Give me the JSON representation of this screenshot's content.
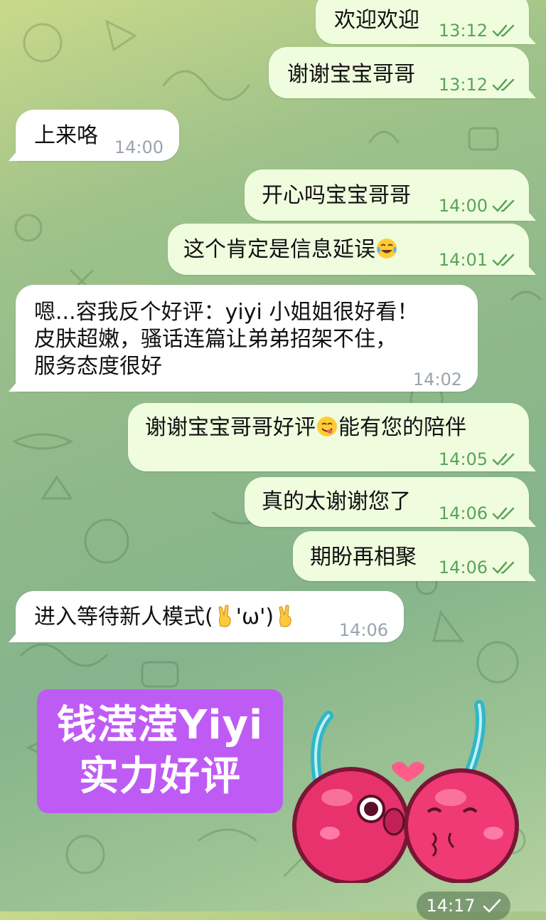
{
  "messages": [
    {
      "id": "m1",
      "dir": "out",
      "text": "欢迎欢迎",
      "time": "13:12",
      "ticks": "double"
    },
    {
      "id": "m2",
      "dir": "out",
      "text": "谢谢宝宝哥哥",
      "time": "13:12",
      "ticks": "double"
    },
    {
      "id": "m3",
      "dir": "in",
      "text": "上来咯",
      "time": "14:00"
    },
    {
      "id": "m4",
      "dir": "out",
      "text": "开心吗宝宝哥哥",
      "time": "14:00",
      "ticks": "double"
    },
    {
      "id": "m5",
      "dir": "out",
      "text": "这个肯定是信息延误",
      "emoji": "tears-of-joy",
      "time": "14:01",
      "ticks": "double"
    },
    {
      "id": "m6",
      "dir": "in",
      "lines": [
        "嗯...容我反个好评：yiyi 小姐姐很好看！",
        "皮肤超嫩，骚话连篇让弟弟招架不住，",
        "服务态度很好"
      ],
      "time": "14:02"
    },
    {
      "id": "m7",
      "dir": "out",
      "text_before": "谢谢宝宝哥哥好评",
      "emoji": "yum-face",
      "text_after": "能有您的陪伴",
      "time": "14:05",
      "ticks": "double"
    },
    {
      "id": "m8",
      "dir": "out",
      "text": "真的太谢谢您了",
      "time": "14:06",
      "ticks": "double"
    },
    {
      "id": "m9",
      "dir": "out",
      "text": "期盼再相聚",
      "time": "14:06",
      "ticks": "double"
    },
    {
      "id": "m10",
      "dir": "in",
      "text_before": "进入等待新人模式(",
      "emoji_1": "victory-hand",
      "text_middle": "'ω')",
      "emoji_2": "victory-hand",
      "time": "14:06"
    }
  ],
  "sticker_text": {
    "line1": "钱滢滢Yiyi",
    "line2": "实力好评",
    "bg_color": "#bf5bf5"
  },
  "cherry_sticker": {
    "icon": "kissing-cherries-sticker",
    "time": "14:17",
    "ticks": "single"
  },
  "colors": {
    "out_bubble": "#effdde",
    "in_bubble": "#ffffff",
    "tick_green": "#5aa35a"
  }
}
